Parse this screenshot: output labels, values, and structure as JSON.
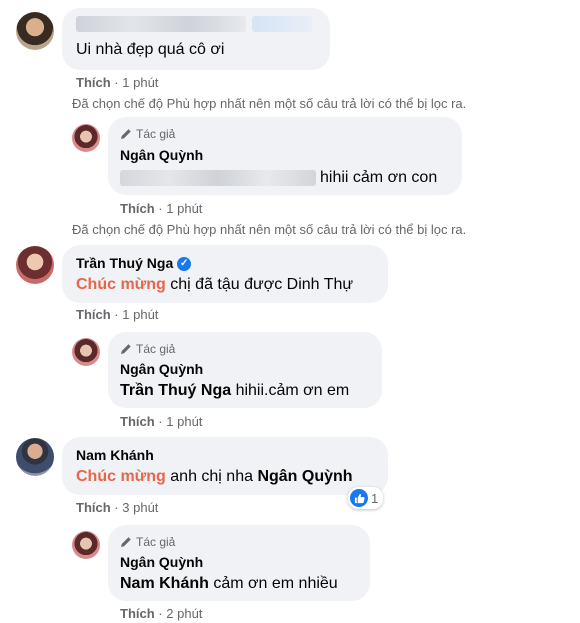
{
  "comments": [
    {
      "text": "Ui nhà đẹp quá cô ơi",
      "action": "Thích",
      "time": "1 phút",
      "notice": "Đã chọn chế độ Phù hợp nhất nên một số câu trả lời có thể bị lọc ra.",
      "reply": {
        "author_tag": "Tác giả",
        "name": "Ngân Quỳnh",
        "text": "hihii cảm ơn con",
        "action": "Thích",
        "time": "1 phút"
      }
    },
    {
      "name": "Trần Thuý Nga",
      "highlight": "Chúc mừng",
      "text": "chị đã tậu được Dinh Thự",
      "action": "Thích",
      "time": "1 phút",
      "reply": {
        "author_tag": "Tác giả",
        "name": "Ngân Quỳnh",
        "mention": "Trần Thuý Nga",
        "text": "hihii.cảm ơn em",
        "action": "Thích",
        "time": "1 phút"
      }
    },
    {
      "name": "Nam Khánh",
      "highlight": "Chúc mừng",
      "text": "anh chị nha",
      "mention": "Ngân Quỳnh",
      "reaction_count": "1",
      "action": "Thích",
      "time": "3 phút",
      "reply": {
        "author_tag": "Tác giả",
        "name": "Ngân Quỳnh",
        "mention": "Nam Khánh",
        "text": "cảm ơn em nhiều",
        "action": "Thích",
        "time": "2 phút"
      }
    }
  ],
  "separator": "·",
  "colors": {
    "bubble": "#f0f2f5",
    "meta": "#65676b",
    "highlight": "#e5674a",
    "like": "#1877f2"
  },
  "icons": {
    "author_tag": "pencil-icon",
    "verified": "verified-badge-icon",
    "reaction": "like-icon"
  }
}
